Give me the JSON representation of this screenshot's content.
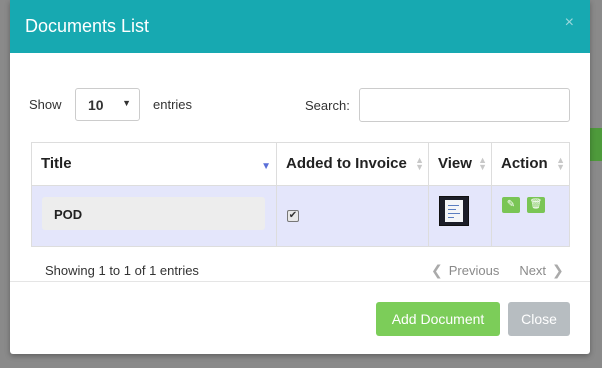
{
  "modal": {
    "title": "Documents List",
    "close_glyph": "×"
  },
  "controls": {
    "show_label": "Show",
    "entries_value": "10",
    "entries_label": "entries",
    "search_label": "Search:",
    "search_value": ""
  },
  "table": {
    "headers": [
      "Title",
      "Added to Invoice",
      "View",
      "Action"
    ],
    "rows": [
      {
        "title": "POD",
        "added_to_invoice": true,
        "view": "document-thumbnail-icon"
      }
    ]
  },
  "info_text": "Showing 1 to 1 of 1 entries",
  "pager": {
    "previous": "Previous",
    "next": "Next"
  },
  "footer": {
    "add_label": "Add Document",
    "close_label": "Close"
  },
  "colors": {
    "header": "#17a9b1",
    "add_button": "#7ccd59",
    "close_button": "#b7bdc1",
    "row_highlight": "#e4e6fb"
  }
}
